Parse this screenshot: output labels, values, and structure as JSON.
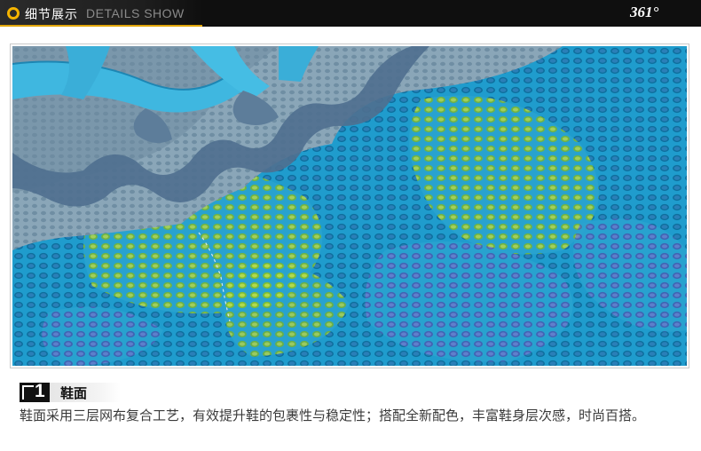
{
  "header": {
    "title_cn": "细节展示",
    "title_en": "DETAILS SHOW",
    "brand": "361°",
    "icon": "ring-bullet-icon",
    "accent_color": "#f5b400"
  },
  "photo": {
    "subject": "blue mesh shoe upper close-up",
    "colors": {
      "mesh": "#2aa8d6",
      "accent": "#9bd23a",
      "lace": "#3fb7e0",
      "overlay": "#7a8fa8"
    }
  },
  "feature": {
    "number": "1",
    "title": "鞋面",
    "description": "鞋面采用三层网布复合工艺，有效提升鞋的包裹性与稳定性；搭配全新配色，丰富鞋身层次感，时尚百搭。"
  }
}
